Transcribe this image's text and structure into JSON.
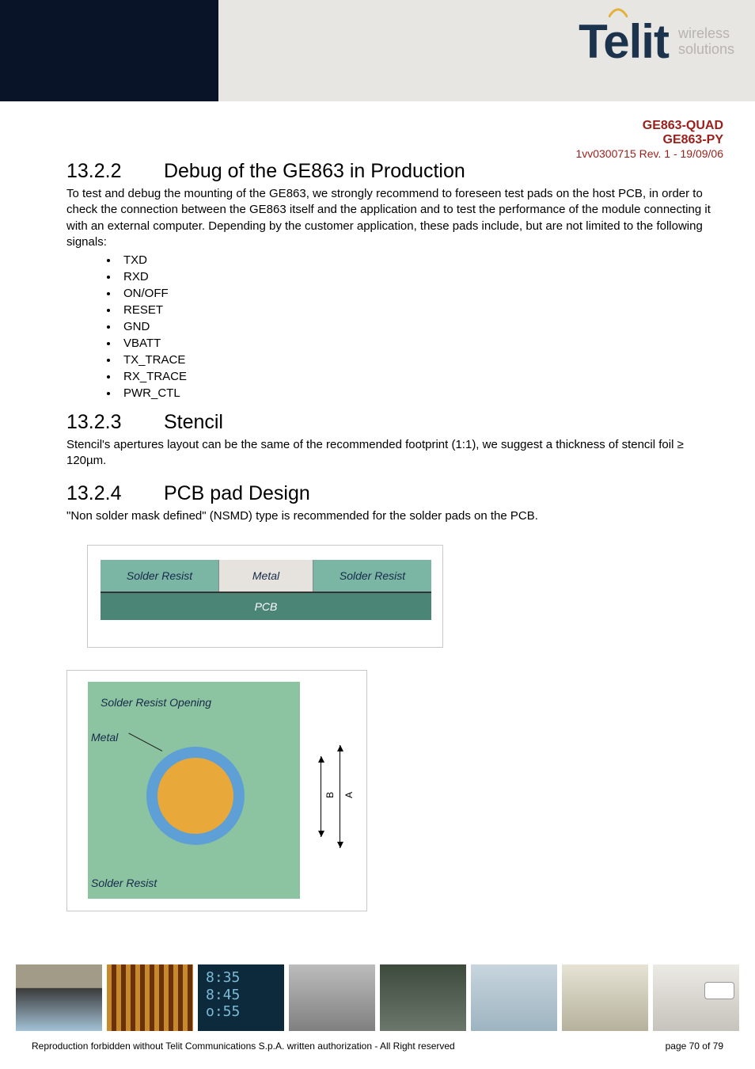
{
  "header": {
    "logo_text": "Telit",
    "tagline_line1": "wireless",
    "tagline_line2": "solutions"
  },
  "doc_meta": {
    "model1": "GE863-QUAD",
    "model2": "GE863-PY",
    "rev": "1vv0300715 Rev. 1 - 19/09/06"
  },
  "sections": {
    "s1": {
      "num": "13.2.2",
      "title": "Debug of the GE863 in Production"
    },
    "s2": {
      "num": "13.2.3",
      "title": "Stencil"
    },
    "s3": {
      "num": "13.2.4",
      "title": "PCB pad Design"
    }
  },
  "body": {
    "debug_p": "To test and debug the mounting of the GE863, we strongly recommend to foreseen test pads on the host PCB, in order to check the connection between the GE863 itself and the application and  to test the performance of the module connecting it with an external computer. Depending by the customer application, these pads include, but are not limited to the following signals:",
    "stencil_p": "Stencil's apertures layout can be the same of the recommended footprint (1:1), we suggest a thickness of stencil foil ≥ 120µm.",
    "pcb_p": "\"Non solder mask defined\" (NSMD) type is recommended for the solder pads on the PCB."
  },
  "signals": [
    "TXD",
    "RXD",
    "ON/OFF",
    "RESET",
    "GND",
    "VBATT",
    "TX_TRACE",
    "RX_TRACE",
    "PWR_CTL"
  ],
  "fig1": {
    "solder_resist": "Solder Resist",
    "metal": "Metal",
    "pcb": "PCB"
  },
  "fig2": {
    "solder_resist_opening": "Solder Resist Opening",
    "metal": "Metal",
    "solder_resist": "Solder Resist",
    "dim_a": "A",
    "dim_b": "B"
  },
  "footer": {
    "copyright": "Reproduction forbidden without Telit Communications S.p.A. written authorization - All Right reserved",
    "page": "page 70 of 79"
  }
}
